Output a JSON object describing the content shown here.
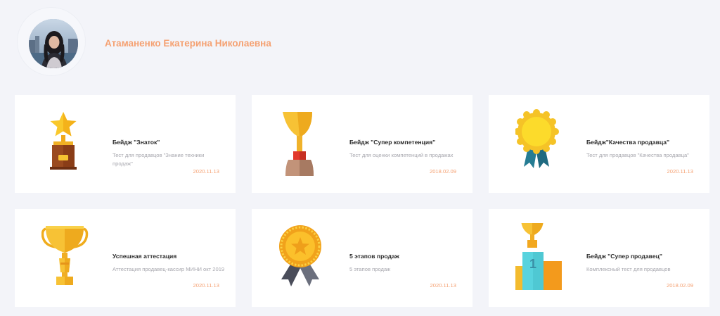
{
  "user": {
    "name": "Атаманенко Екатерина Николаевна"
  },
  "badges": [
    {
      "title": "Бейдж \"Знаток\"",
      "description": "Тест для продавцов \"Знание техники продаж\"",
      "date": "2020.11.13",
      "icon": "star-trophy-icon"
    },
    {
      "title": "Бейдж \"Супер компетенция\"",
      "description": "Тест для оценки компетенций в продажах",
      "date": "2018.02.09",
      "icon": "cup-trophy-icon"
    },
    {
      "title": "Бейдж\"Качества продавца\"",
      "description": "Тест для продавцов \"Качества продавца\"",
      "date": "2020.11.13",
      "icon": "rosette-medal-icon"
    },
    {
      "title": "Успешная аттестация",
      "description": "Аттестация продавец-кассир МИНИ окт 2019",
      "date": "2020.11.13",
      "icon": "handled-cup-icon"
    },
    {
      "title": "5 этапов продаж",
      "description": "5 этапов продаж",
      "date": "2020.11.13",
      "icon": "star-medal-ribbon-icon"
    },
    {
      "title": "Бейдж \"Супер продавец\"",
      "description": "Комплексный тест для продавцов",
      "date": "2018.02.09",
      "icon": "podium-trophy-icon"
    }
  ],
  "colors": {
    "accent": "#f5a172",
    "background": "#f3f4f9",
    "card": "#ffffff"
  }
}
